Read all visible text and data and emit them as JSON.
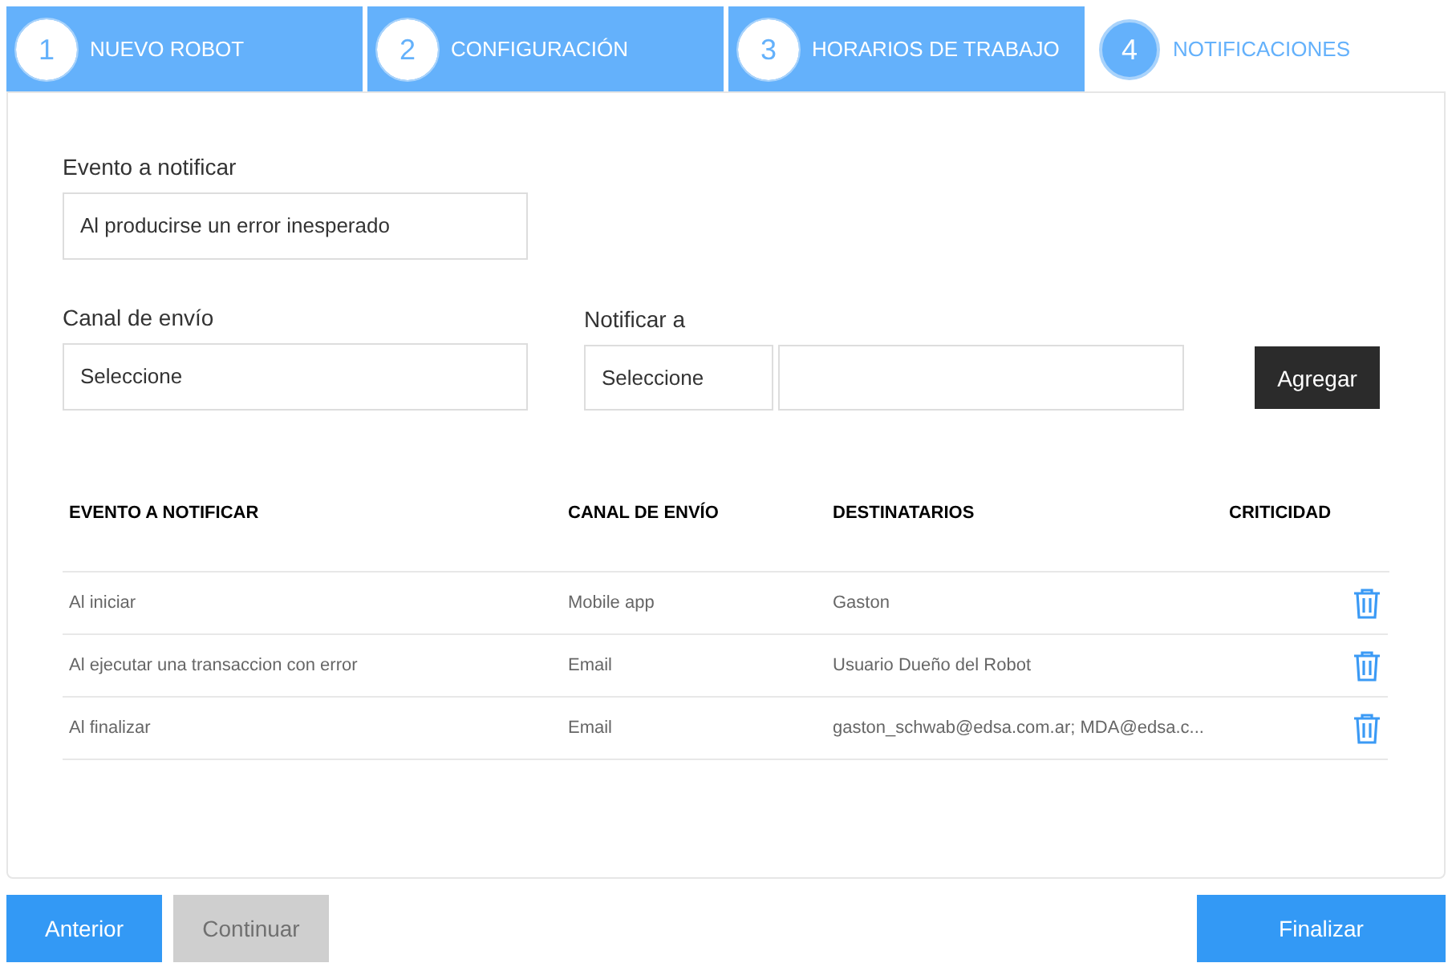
{
  "steps": [
    {
      "number": "1",
      "label": "NUEVO ROBOT",
      "selected": false
    },
    {
      "number": "2",
      "label": "CONFIGURACIÓN",
      "selected": false
    },
    {
      "number": "3",
      "label": "HORARIOS DE TRABAJO",
      "selected": false
    },
    {
      "number": "4",
      "label": "NOTIFICACIONES",
      "selected": true
    }
  ],
  "event_field": {
    "label": "Evento a notificar",
    "value": "Al producirse un error inesperado"
  },
  "channel_field": {
    "label": "Canal de envío",
    "value": "Seleccione"
  },
  "notify_field": {
    "label": "Notificar a",
    "value": "Seleccione"
  },
  "add_button": "Agregar",
  "table": {
    "columns": [
      "EVENTO A NOTIFICAR",
      "CANAL DE ENVÍO",
      "DESTINATARIOS",
      "CRITICIDAD"
    ],
    "rows": [
      {
        "event": "Al iniciar",
        "channel": "Mobile app",
        "recipients": "Gaston"
      },
      {
        "event": "Al ejecutar una transaccion con error",
        "channel": "Email",
        "recipients": "Usuario Dueño del Robot"
      },
      {
        "event": "Al finalizar",
        "channel": "Email",
        "recipients": "gaston_schwab@edsa.com.ar; MDA@edsa.c..."
      }
    ]
  },
  "buttons": [
    {
      "label": "Anterior",
      "disabled": false
    },
    {
      "label": "Continuar",
      "disabled": true
    }
  ],
  "finish_button": "Finalizar"
}
